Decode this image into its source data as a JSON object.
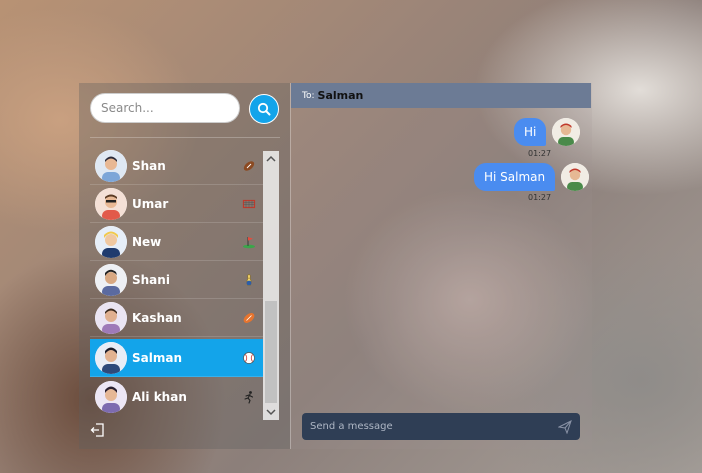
{
  "search": {
    "placeholder": "Search..."
  },
  "contacts": [
    {
      "name": "Shan",
      "icon": "football-icon",
      "active": false
    },
    {
      "name": "Umar",
      "icon": "goal-net-icon",
      "active": false
    },
    {
      "name": "New",
      "icon": "golf-icon",
      "active": false
    },
    {
      "name": "Shani",
      "icon": "bowling-icon",
      "active": false
    },
    {
      "name": "Kashan",
      "icon": "rugby-icon",
      "active": false
    },
    {
      "name": "Salman",
      "icon": "baseball-icon",
      "active": true
    },
    {
      "name": "Ali khan",
      "icon": "runner-icon",
      "active": false
    }
  ],
  "chat": {
    "to_label": "To:",
    "to_name": "Salman",
    "messages": [
      {
        "text": "Hi",
        "time": "01:27"
      },
      {
        "text": "Hi Salman",
        "time": "01:27"
      }
    ],
    "composer_placeholder": "Send a message"
  },
  "colors": {
    "accent": "#13a4ea",
    "bubble": "#4a8cf0",
    "header": "#6c7b95",
    "composer": "#2f3e55"
  }
}
